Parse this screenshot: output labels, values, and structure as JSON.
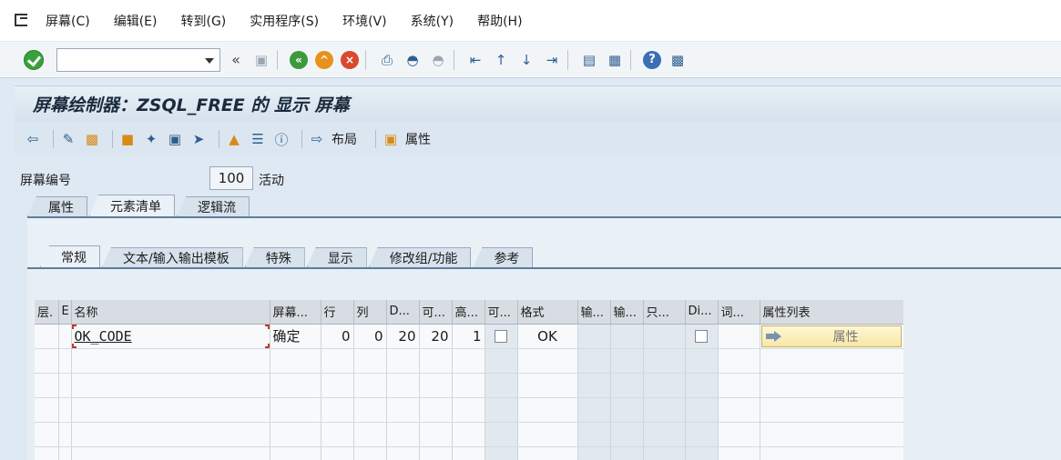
{
  "menu": [
    "屏幕(C)",
    "编辑(E)",
    "转到(G)",
    "实用程序(S)",
    "环境(V)",
    "系统(Y)",
    "帮助(H)"
  ],
  "toolbar": {
    "command_value": "",
    "back_label": "«"
  },
  "title": "屏幕绘制器：ZSQL_FREE 的 显示 屏幕",
  "apptoolbar": {
    "layout_label": "布局",
    "attributes_label": "属性"
  },
  "screen": {
    "label": "屏幕编号",
    "number": "100",
    "status": "活动"
  },
  "tabs_outer": [
    "属性",
    "元素清单",
    "逻辑流"
  ],
  "tabs_inner": [
    "常规",
    "文本/输入输出模板",
    "特殊",
    "显示",
    "修改组/功能",
    "参考"
  ],
  "table": {
    "headers": [
      "层.",
      "E",
      "名称",
      "屏幕...",
      "行",
      "列",
      "D...",
      "可...",
      "高...",
      "可...",
      "格式",
      "输...",
      "输...",
      "只...",
      "Di...",
      "词...",
      "属性列表"
    ],
    "row": {
      "name": "OK_CODE",
      "screen_text": "确定",
      "line": "0",
      "column": "0",
      "def_len": "20",
      "vis_len": "20",
      "height": "1",
      "format": "OK",
      "attr_button": "属性"
    }
  },
  "colors": {
    "accent": "#5d7d9e",
    "title_bg": "#d6e2ee",
    "ok_green": "#3aa13a"
  }
}
